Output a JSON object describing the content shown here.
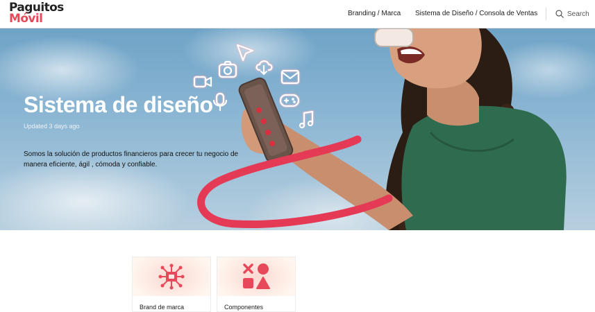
{
  "brand": {
    "line1": "Paguitos",
    "line2": "Móvil"
  },
  "nav": {
    "branding": "Branding / Marca",
    "sistema": "Sistema de Diseño / Consola de Ventas",
    "search_label": "Search"
  },
  "hero": {
    "title": "Sistema de diseño",
    "updated": "Updated 3 days ago",
    "description": "Somos la solución de productos financieros para crecer tu negocio de manera eficiente, ágil , cómoda y confiable."
  },
  "cards": [
    {
      "label": "Brand de marca",
      "icon": "network-hub-icon"
    },
    {
      "label": "Componentes",
      "icon": "shapes-icon"
    }
  ],
  "hero_icons": [
    "video-camera-icon",
    "camera-icon",
    "cursor-icon",
    "cloud-download-icon",
    "mail-icon",
    "microphone-icon",
    "gamepad-icon",
    "music-note-icon"
  ],
  "colors": {
    "accent": "#e8495a",
    "hero_sky": "#8db7d4",
    "dress": "#2f6b4e"
  }
}
